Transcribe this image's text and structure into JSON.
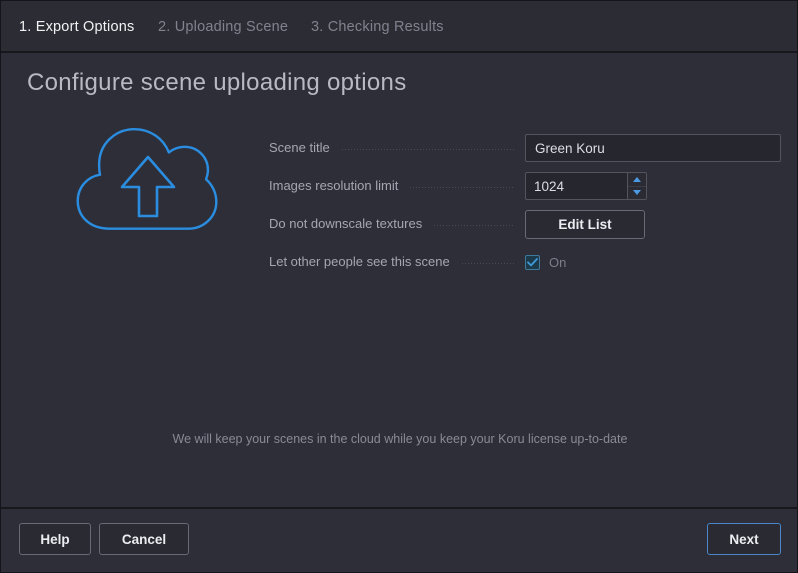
{
  "window": {
    "background": "#2e2e38",
    "accent": "#2a8de0"
  },
  "stepbar": {
    "steps": [
      {
        "label": "1. Export Options",
        "state": "active"
      },
      {
        "label": "2. Uploading Scene",
        "state": "inactive"
      },
      {
        "label": "3. Checking Results",
        "state": "inactive"
      }
    ]
  },
  "header": {
    "title": "Configure scene uploading options"
  },
  "illustration": {
    "icon": "cloud-upload-icon",
    "color": "#2a8de0"
  },
  "form": {
    "rows": [
      {
        "label": "Scene title",
        "control": "text-input",
        "value": "Green Koru",
        "placeholder": ""
      },
      {
        "label": "Images resolution limit",
        "control": "number-spinner",
        "value": "1024"
      },
      {
        "label": "Do not downscale textures",
        "control": "button",
        "value": "Edit List"
      },
      {
        "label": "Let other people see this scene",
        "control": "checkbox",
        "checked": true,
        "value": "On"
      }
    ]
  },
  "footnote": {
    "text": "We will keep your scenes in the cloud while you keep your Koru license up-to-date"
  },
  "bottombar": {
    "help_label": "Help",
    "cancel_label": "Cancel",
    "next_label": "Next"
  }
}
